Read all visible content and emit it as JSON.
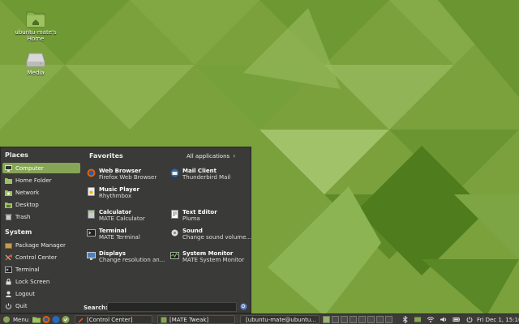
{
  "desktop": {
    "icons": [
      {
        "label": "ubuntu-mate's\nHome",
        "icon": "home-folder-icon"
      },
      {
        "label": "Media",
        "icon": "drive-icon"
      }
    ]
  },
  "menu": {
    "places_title": "Places",
    "places": [
      {
        "label": "Computer",
        "icon": "computer-icon",
        "active": true
      },
      {
        "label": "Home Folder",
        "icon": "home-folder-icon"
      },
      {
        "label": "Network",
        "icon": "network-icon"
      },
      {
        "label": "Desktop",
        "icon": "desktop-icon"
      },
      {
        "label": "Trash",
        "icon": "trash-icon"
      }
    ],
    "system_title": "System",
    "system": [
      {
        "label": "Package Manager",
        "icon": "package-icon"
      },
      {
        "label": "Control Center",
        "icon": "control-center-icon"
      },
      {
        "label": "Terminal",
        "icon": "terminal-icon"
      },
      {
        "label": "Lock Screen",
        "icon": "lock-icon"
      },
      {
        "label": "Logout",
        "icon": "logout-icon"
      },
      {
        "label": "Quit",
        "icon": "power-icon"
      }
    ],
    "favorites_title": "Favorites",
    "all_applications": "All applications",
    "favorites": [
      {
        "name": "Web Browser",
        "desc": "Firefox Web Browser",
        "icon": "firefox-icon"
      },
      {
        "name": "Mail Client",
        "desc": "Thunderbird Mail",
        "icon": "thunderbird-icon"
      },
      {
        "name": "Music Player",
        "desc": "Rhythmbox",
        "icon": "rhythmbox-icon"
      },
      {
        "name": "Calculator",
        "desc": "MATE Calculator",
        "icon": "calculator-icon"
      },
      {
        "name": "Text Editor",
        "desc": "Pluma",
        "icon": "text-editor-icon"
      },
      {
        "name": "Terminal",
        "desc": "MATE Terminal",
        "icon": "terminal-icon"
      },
      {
        "name": "Sound",
        "desc": "Change sound volume...",
        "icon": "sound-icon"
      },
      {
        "name": "Displays",
        "desc": "Change resolution an...",
        "icon": "display-icon"
      },
      {
        "name": "System Monitor",
        "desc": "MATE System Monitor",
        "icon": "system-monitor-icon"
      }
    ],
    "search_label": "Search:",
    "search_value": ""
  },
  "taskbar": {
    "menu_label": "Menu",
    "tasks": [
      {
        "label": "[Control Center]",
        "icon": "control-center-icon"
      },
      {
        "label": "[MATE Tweak]",
        "icon": "tweak-icon"
      },
      {
        "label": "[ubuntu-mate@ubuntu...",
        "icon": "terminal-icon"
      }
    ],
    "clock": "Fri Dec  1, 15:10"
  },
  "colors": {
    "menu_bg": "#3a3a38",
    "accent": "#87a556",
    "taskbar_bg": "#3c3b37"
  }
}
